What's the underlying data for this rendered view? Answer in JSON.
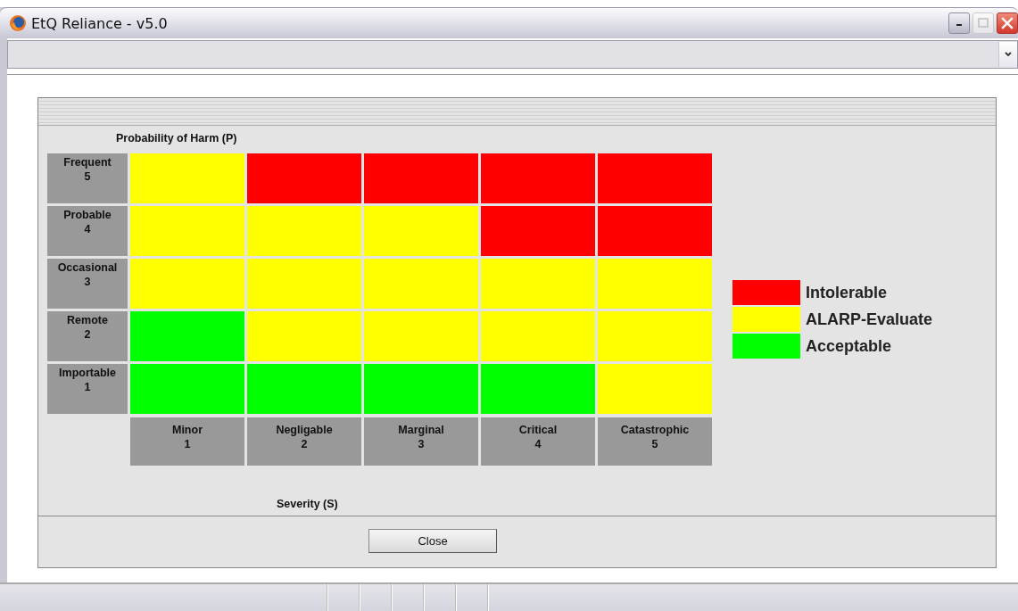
{
  "window": {
    "title": "EtQ Reliance - v5.0"
  },
  "matrix": {
    "y_axis_title": "Probability of Harm (P)",
    "x_axis_title": "Severity (S)",
    "rows": [
      {
        "label": "Frequent",
        "number": "5",
        "cells": [
          {
            "kind": "alarp"
          },
          {
            "kind": "intolerable"
          },
          {
            "kind": "intolerable"
          },
          {
            "kind": "intolerable"
          },
          {
            "kind": "intolerable"
          }
        ]
      },
      {
        "label": "Probable",
        "number": "4",
        "cells": [
          {
            "kind": "alarp"
          },
          {
            "kind": "alarp"
          },
          {
            "kind": "alarp"
          },
          {
            "kind": "intolerable"
          },
          {
            "kind": "intolerable"
          }
        ]
      },
      {
        "label": "Occasional",
        "number": "3",
        "cells": [
          {
            "kind": "alarp"
          },
          {
            "kind": "alarp"
          },
          {
            "kind": "alarp"
          },
          {
            "kind": "alarp"
          },
          {
            "kind": "alarp"
          }
        ]
      },
      {
        "label": "Remote",
        "number": "2",
        "cells": [
          {
            "kind": "acceptable"
          },
          {
            "kind": "alarp"
          },
          {
            "kind": "alarp"
          },
          {
            "kind": "alarp"
          },
          {
            "kind": "alarp"
          }
        ]
      },
      {
        "label": "Importable",
        "number": "1",
        "cells": [
          {
            "kind": "acceptable"
          },
          {
            "kind": "acceptable"
          },
          {
            "kind": "acceptable"
          },
          {
            "kind": "acceptable"
          },
          {
            "kind": "alarp"
          }
        ]
      }
    ],
    "columns": [
      {
        "label": "Minor",
        "number": "1"
      },
      {
        "label": "Negligable",
        "number": "2"
      },
      {
        "label": "Marginal",
        "number": "3"
      },
      {
        "label": "Critical",
        "number": "4"
      },
      {
        "label": "Catastrophic",
        "number": "5"
      }
    ]
  },
  "legend": [
    {
      "kind": "intolerable",
      "label": "Intolerable",
      "color": "#ff0000"
    },
    {
      "kind": "alarp",
      "label": "ALARP-Evaluate",
      "color": "#ffff00"
    },
    {
      "kind": "acceptable",
      "label": "Acceptable",
      "color": "#00ff00"
    }
  ],
  "buttons": [
    "Close"
  ]
}
